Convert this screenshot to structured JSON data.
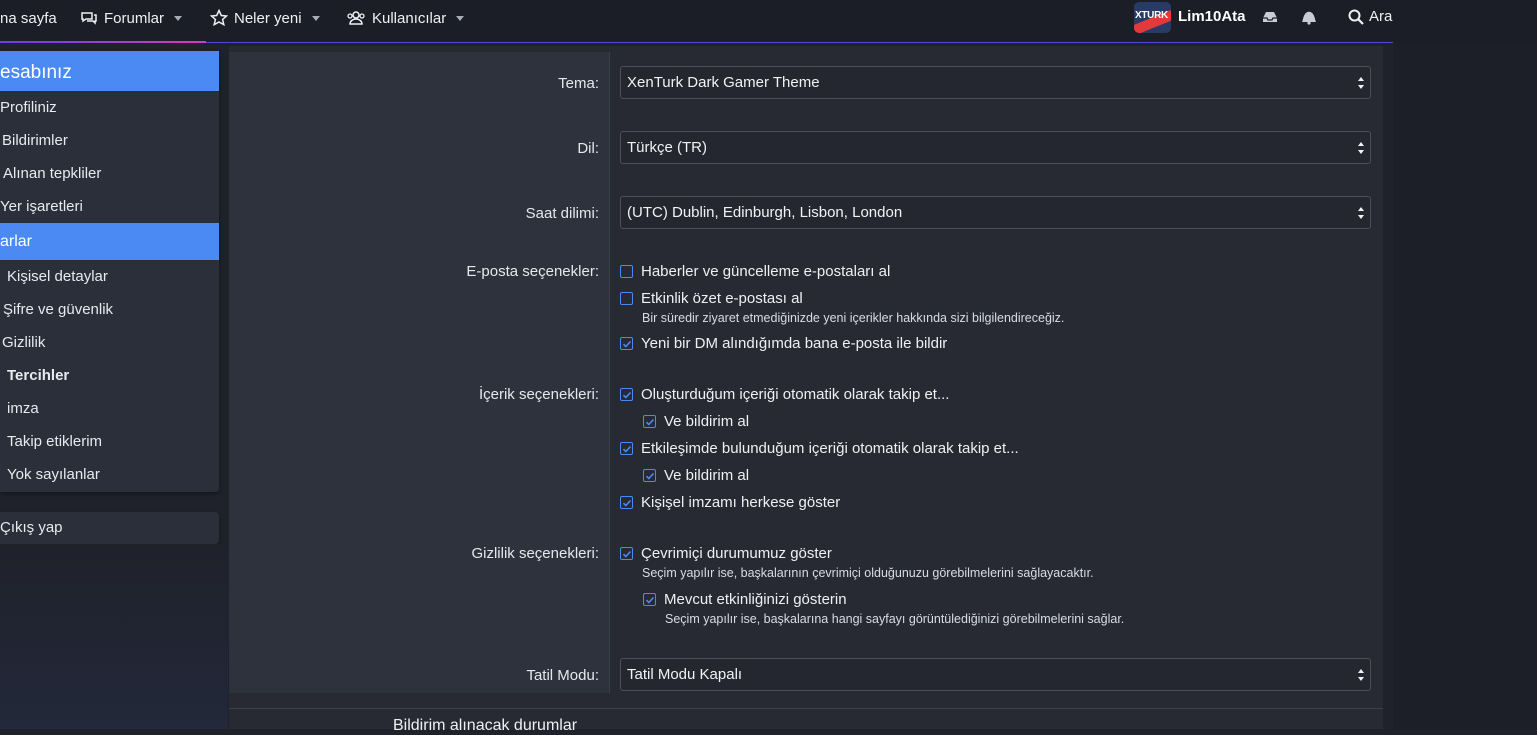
{
  "nav": {
    "home_label": "na sayfa",
    "forums_label": "Forumlar",
    "whats_new_label": "Neler yeni",
    "members_label": "Kullanıcılar",
    "logo_text": "XTURK",
    "username": "Lim10Ata",
    "search_label": "Ara"
  },
  "sidebar": {
    "account_header": "esabınız",
    "account_items": [
      "Profiliniz",
      "Bildirimler",
      "Alınan tepkliler",
      "Yer işaretleri"
    ],
    "settings_header": "arlar",
    "settings_items": [
      "Kişisel detaylar",
      "Şifre ve güvenlik",
      "Gizlilik",
      "Tercihler",
      "imza",
      "Takip etiklerim",
      "Yok sayılanlar"
    ],
    "logout_label": "Çıkış yap"
  },
  "form": {
    "theme_label": "Tema:",
    "theme_value": "XenTurk Dark Gamer Theme",
    "language_label": "Dil:",
    "language_value": "Türkçe (TR)",
    "timezone_label": "Saat dilimi:",
    "timezone_value": "(UTC) Dublin, Edinburgh, Lisbon, London",
    "email_label": "E-posta seçenekler:",
    "email_opt1": "Haberler ve güncelleme e-postaları al",
    "email_opt2": "Etkinlik özet e-postası al",
    "email_opt2_hint": "Bir süredir ziyaret etmediğinizde yeni içerikler hakkında sizi bilgilendireceğiz.",
    "email_opt3": "Yeni bir DM alındığımda bana e-posta ile bildir",
    "content_label": "İçerik seçenekleri:",
    "content_opt1": "Oluşturduğum içeriği otomatik olarak takip et...",
    "content_opt1_sub": "Ve bildirim al",
    "content_opt2": "Etkileşimde bulunduğum içeriği otomatik olarak takip et...",
    "content_opt2_sub": "Ve bildirim al",
    "content_opt3": "Kişişel imzamı herkese göster",
    "privacy_label": "Gizlilik seçenekleri:",
    "privacy_opt1": "Çevrimiçi durumumuz göster",
    "privacy_opt1_hint": "Seçim yapılır ise, başkalarının çevrimiçi olduğunuzu görebilmelerini sağlayacaktır.",
    "privacy_opt2": "Mevcut etkinliğinizi gösterin",
    "privacy_opt2_hint": "Seçim yapılır ise, başkalarına hangi sayfayı görüntülediğinizi görebilmelerini sağlar.",
    "vacation_label": "Tatil Modu:",
    "vacation_value": "Tatil Modu Kapalı",
    "bottom_heading": "Bildirim alınacak durumlar"
  },
  "colors": {
    "accent": "#4a8af2",
    "background": "#1f222b",
    "panel": "#272a33"
  }
}
